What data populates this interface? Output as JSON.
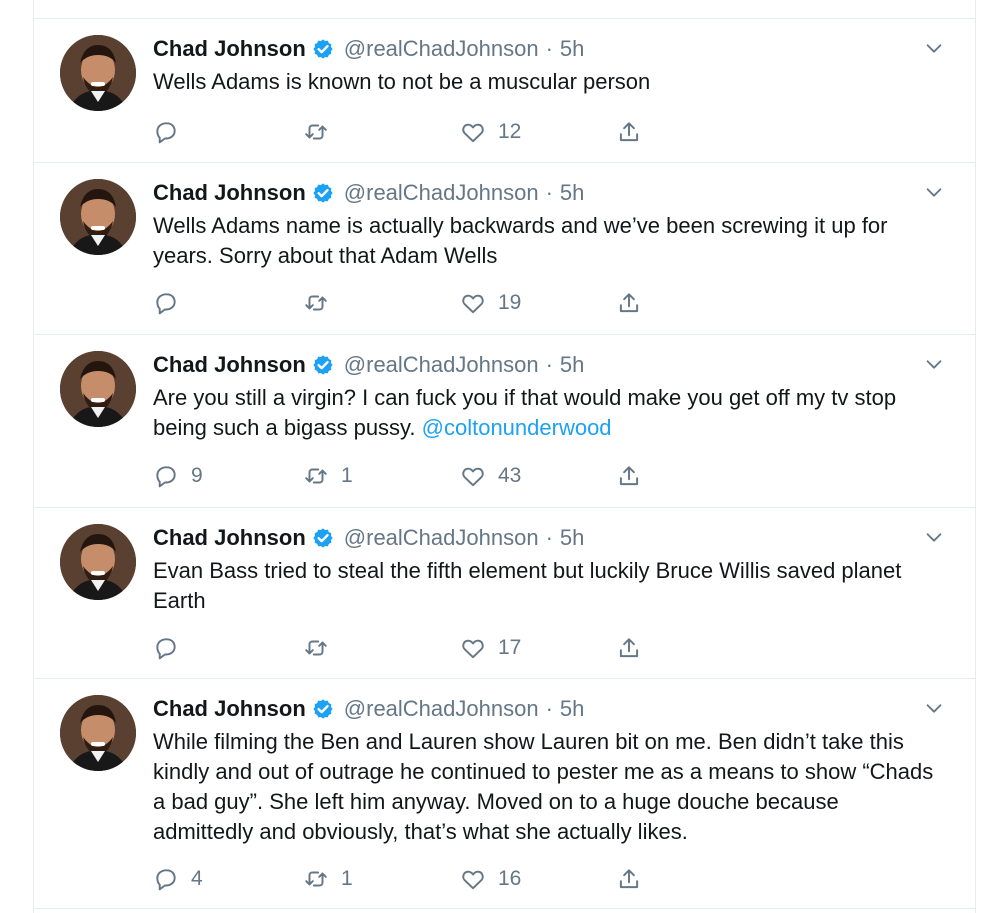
{
  "tweets": [
    {
      "name": "Chad Johnson",
      "handle": "@realChadJohnson",
      "dot": "·",
      "time": "5h",
      "text": "Wells Adams is known to not be a muscular person",
      "mention": "",
      "replies": "",
      "retweets": "",
      "likes": "12"
    },
    {
      "name": "Chad Johnson",
      "handle": "@realChadJohnson",
      "dot": "·",
      "time": "5h",
      "text": "Wells Adams name is actually backwards and we’ve been screwing it up for years. Sorry about that Adam Wells",
      "mention": "",
      "replies": "",
      "retweets": "",
      "likes": "19"
    },
    {
      "name": "Chad Johnson",
      "handle": "@realChadJohnson",
      "dot": "·",
      "time": "5h",
      "text": "Are you still a virgin? I can fuck you if that would make you get off my tv stop being such a bigass pussy. ",
      "mention": "@coltonunderwood",
      "replies": "9",
      "retweets": "1",
      "likes": "43"
    },
    {
      "name": "Chad Johnson",
      "handle": "@realChadJohnson",
      "dot": "·",
      "time": "5h",
      "text": "Evan Bass tried to steal the fifth element but luckily Bruce Willis saved planet Earth",
      "mention": "",
      "replies": "",
      "retweets": "",
      "likes": "17"
    },
    {
      "name": "Chad Johnson",
      "handle": "@realChadJohnson",
      "dot": "·",
      "time": "5h",
      "text": "While filming the Ben and Lauren show Lauren bit on me. Ben didn’t take this kindly and out of outrage he continued to pester me as a means to show “Chads a bad guy”. She left him anyway. Moved on to a huge douche because admittedly and obviously, that’s what she actually likes.",
      "mention": "",
      "replies": "4",
      "retweets": "1",
      "likes": "16"
    }
  ],
  "icons": {
    "verified": "verified-badge-icon",
    "caret": "chevron-down-icon",
    "reply": "reply-icon",
    "retweet": "retweet-icon",
    "like": "heart-icon",
    "share": "share-icon"
  },
  "colors": {
    "accent": "#1da1f2",
    "secondary": "#657786",
    "border": "#e6ecf0"
  }
}
